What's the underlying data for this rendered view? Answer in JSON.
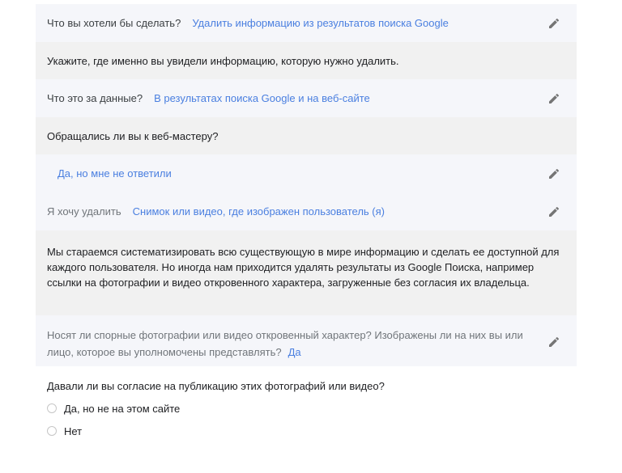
{
  "form": {
    "q1": {
      "label": "Что вы хотели бы сделать?",
      "value": "Удалить информацию из результатов поиска Google"
    },
    "instruction": "Укажите, где именно вы увидели информацию, которую нужно удалить.",
    "q2": {
      "label": "Что это за данные?",
      "value": "В результатах поиска Google и на веб-сайте"
    },
    "q3": {
      "question": "Обращались ли вы к веб-мастеру?",
      "value": "Да, но мне не ответили"
    },
    "q4": {
      "label": "Я хочу удалить",
      "value": "Снимок или видео, где изображен пользователь (я)"
    },
    "info_text": "Мы стараемся систематизировать всю существующую в мире информацию и сделать ее доступной для каждого пользователя. Но иногда нам приходится удалять результаты из Google Поиска, например ссылки на фотографии и видео откровенного характера, загруженные без согласия их владельца.",
    "q5": {
      "question": "Носят ли спорные фотографии или видео откровенный характер? Изображены ли на них вы или лицо, которое вы уполномочены представлять?",
      "value": "Да"
    },
    "q6": {
      "question": "Давали ли вы согласие на публикацию этих фотографий или видео?",
      "options": [
        "Да, но не на этом сайте",
        "Нет"
      ]
    }
  },
  "icons": {
    "edit": "pencil-icon",
    "radio": "radio-unchecked-icon"
  },
  "colors": {
    "link": "#4a7fe0",
    "answered_bg": "#f5f6fa",
    "info_bg": "#f1f1f1"
  }
}
